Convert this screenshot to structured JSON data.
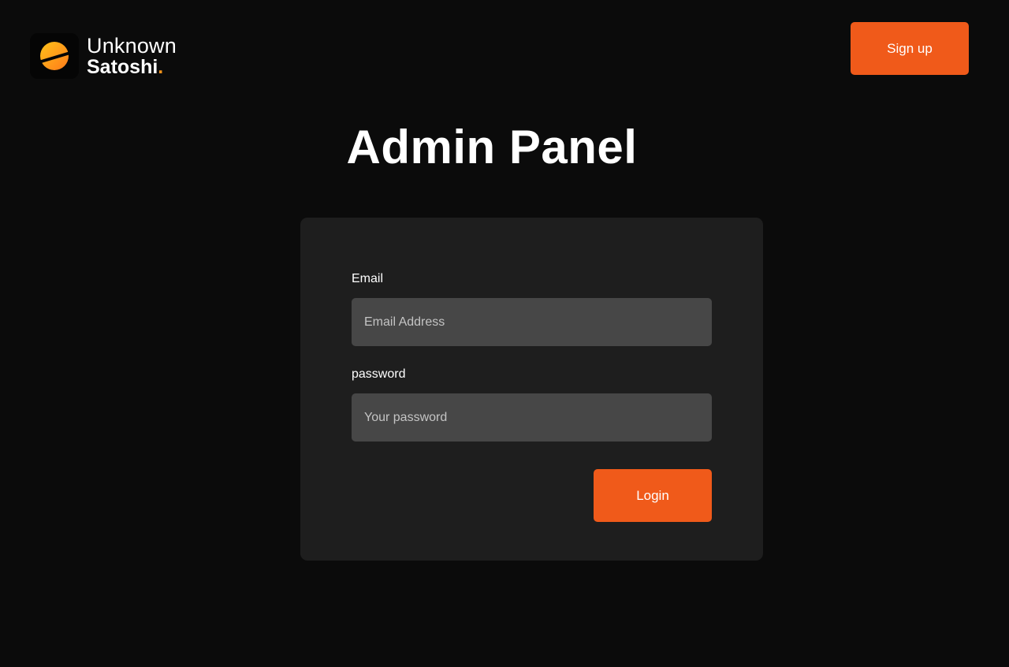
{
  "brand": {
    "name_line1": "Unknown",
    "name_line2": "Satoshi",
    "name_dot": ".",
    "logo_icon": "sun-logo-icon",
    "accent_color": "#f7931a"
  },
  "header": {
    "signup_label": "Sign up"
  },
  "main": {
    "title": "Admin Panel"
  },
  "form": {
    "email_label": "Email",
    "email_placeholder": "Email Address",
    "email_value": "",
    "password_label": "password",
    "password_placeholder": "Your password",
    "password_value": "",
    "login_label": "Login"
  },
  "colors": {
    "background": "#0b0b0b",
    "card": "#1e1e1e",
    "input": "#474747",
    "primary_button": "#f05a1a"
  }
}
